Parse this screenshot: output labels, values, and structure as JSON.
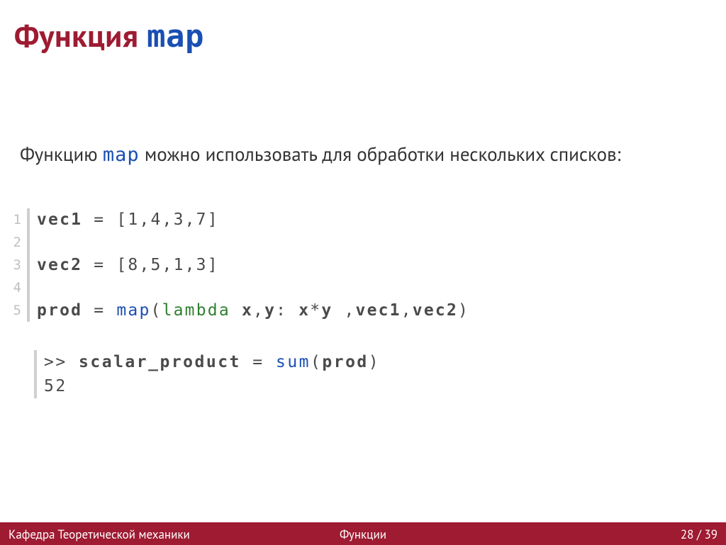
{
  "title": {
    "prefix": "Функция",
    "mono": "map"
  },
  "intro": {
    "before": "Функцию ",
    "mono": "map",
    "after": " можно использовать для обработки нескольких списков:"
  },
  "code": {
    "lines": {
      "n1": "1",
      "n2": "2",
      "n3": "3",
      "n4": "4",
      "n5": "5"
    },
    "l1": {
      "a": "vec1",
      "b": " = [1,4,3,7]"
    },
    "l2": "",
    "l3": {
      "a": "vec2",
      "b": " = [8,5,1,3]"
    },
    "l4": "",
    "l5": {
      "a": "prod",
      "b": " = ",
      "c": "map",
      "d": "(",
      "e": "lambda",
      "f": " ",
      "g": "x",
      "h": ",",
      "i": "y",
      "j": ": ",
      "k": "x",
      "l": "*",
      "m": "y",
      "n": " ,",
      "o": "vec1",
      "p": ",",
      "q": "vec2",
      "r": ")"
    }
  },
  "output": {
    "line1": {
      "a": ">> ",
      "b": "scalar_product",
      "c": " = ",
      "d": "sum",
      "e": "(",
      "f": "prod",
      "g": ")"
    },
    "line2": "52"
  },
  "footer": {
    "left": "Кафедра Теоретической механики",
    "mid": "Функции",
    "right": "28 / 39"
  }
}
